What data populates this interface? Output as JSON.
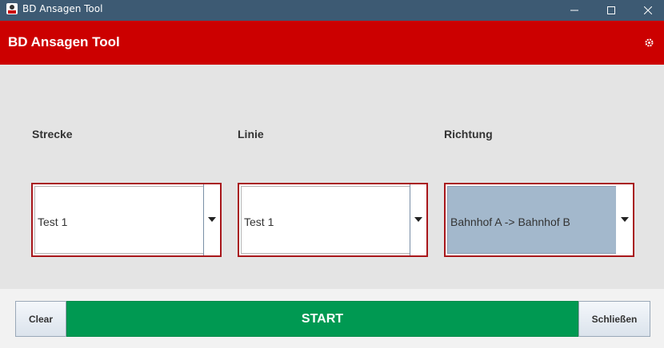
{
  "window": {
    "title": "BD Ansagen Tool"
  },
  "header": {
    "title": "BD Ansagen Tool"
  },
  "fields": {
    "strecke": {
      "label": "Strecke",
      "value": "Test 1"
    },
    "linie": {
      "label": "Linie",
      "value": "Test 1"
    },
    "richtung": {
      "label": "Richtung",
      "value": "Bahnhof A -> Bahnhof B"
    }
  },
  "buttons": {
    "clear": "Clear",
    "start": "START",
    "close": "Schließen"
  },
  "colors": {
    "header": "#cc0000",
    "start": "#009952",
    "combo_border": "#a8161a",
    "titlebar": "#3d5a73"
  }
}
